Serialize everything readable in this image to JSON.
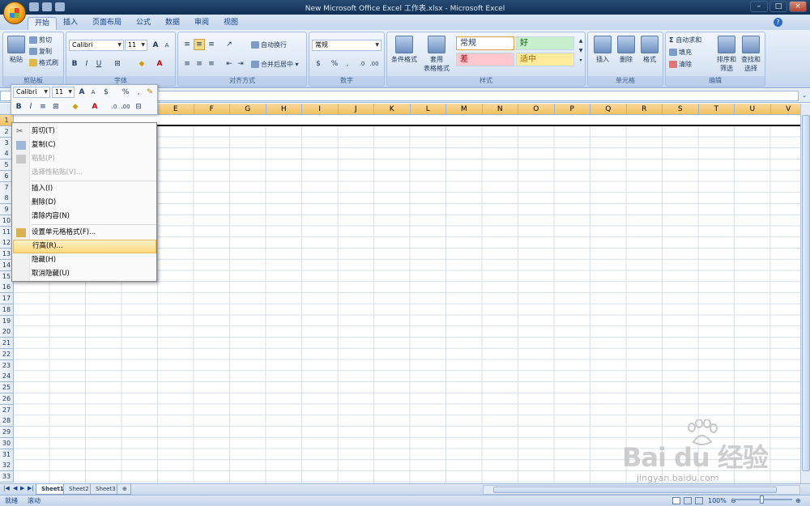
{
  "window": {
    "title": "New Microsoft Office Excel 工作表.xlsx - Microsoft Excel"
  },
  "tabs": [
    "开始",
    "插入",
    "页面布局",
    "公式",
    "数据",
    "审阅",
    "视图"
  ],
  "ribbon": {
    "clipboard": {
      "paste": "粘贴",
      "cut": "剪切",
      "copy": "复制",
      "format_painter": "格式刷",
      "label": "剪贴板"
    },
    "font": {
      "name": "Calibri",
      "size": "11",
      "label": "字体"
    },
    "alignment": {
      "wrap": "自动换行",
      "merge": "合并后居中",
      "label": "对齐方式"
    },
    "number": {
      "format": "常规",
      "label": "数字"
    },
    "styles": {
      "conditional": "条件格式",
      "table": "套用",
      "table2": "表格格式",
      "normal": "常规",
      "good": "好",
      "bad": "差",
      "neutral": "适中",
      "label": "样式"
    },
    "cells": {
      "insert": "插入",
      "delete": "删除",
      "format": "格式",
      "label": "单元格"
    },
    "editing": {
      "autosum": "自动求和",
      "fill": "填充",
      "clear": "清除",
      "sort": "排序和",
      "sort2": "筛选",
      "find": "查找和",
      "find2": "选择",
      "label": "编辑"
    }
  },
  "columns": [
    "E",
    "F",
    "G",
    "H",
    "I",
    "J",
    "K",
    "L",
    "M",
    "N",
    "O",
    "P",
    "Q",
    "R",
    "S",
    "T",
    "U",
    "V"
  ],
  "rows": [
    "1",
    "2",
    "3",
    "4",
    "5",
    "6",
    "7",
    "8",
    "9",
    "10",
    "11",
    "12",
    "13",
    "14",
    "15",
    "16",
    "17",
    "18",
    "19",
    "20",
    "21",
    "22",
    "23",
    "24",
    "25",
    "26",
    "27",
    "28",
    "29",
    "30",
    "31",
    "32",
    "33"
  ],
  "minibar": {
    "font": "Calibri",
    "size": "11"
  },
  "context_menu": [
    {
      "label": "剪切(T)",
      "disabled": false
    },
    {
      "label": "复制(C)",
      "disabled": false
    },
    {
      "label": "粘贴(P)",
      "disabled": true
    },
    {
      "label": "选择性粘贴(V)...",
      "disabled": true
    },
    {
      "label": "插入(I)",
      "disabled": false
    },
    {
      "label": "删除(D)",
      "disabled": false
    },
    {
      "label": "清除内容(N)",
      "disabled": false
    },
    {
      "label": "设置单元格格式(F)...",
      "disabled": false
    },
    {
      "label": "行高(R)...",
      "disabled": false,
      "highlighted": true
    },
    {
      "label": "隐藏(H)",
      "disabled": false
    },
    {
      "label": "取消隐藏(U)",
      "disabled": false
    }
  ],
  "sheets": [
    "Sheet1",
    "Sheet2",
    "Sheet3"
  ],
  "status": {
    "ready": "就绪",
    "scroll": "滚动",
    "zoom": "100%"
  },
  "watermark": {
    "brand": "Bai du 经验",
    "url": "jingyan.baidu.com"
  }
}
